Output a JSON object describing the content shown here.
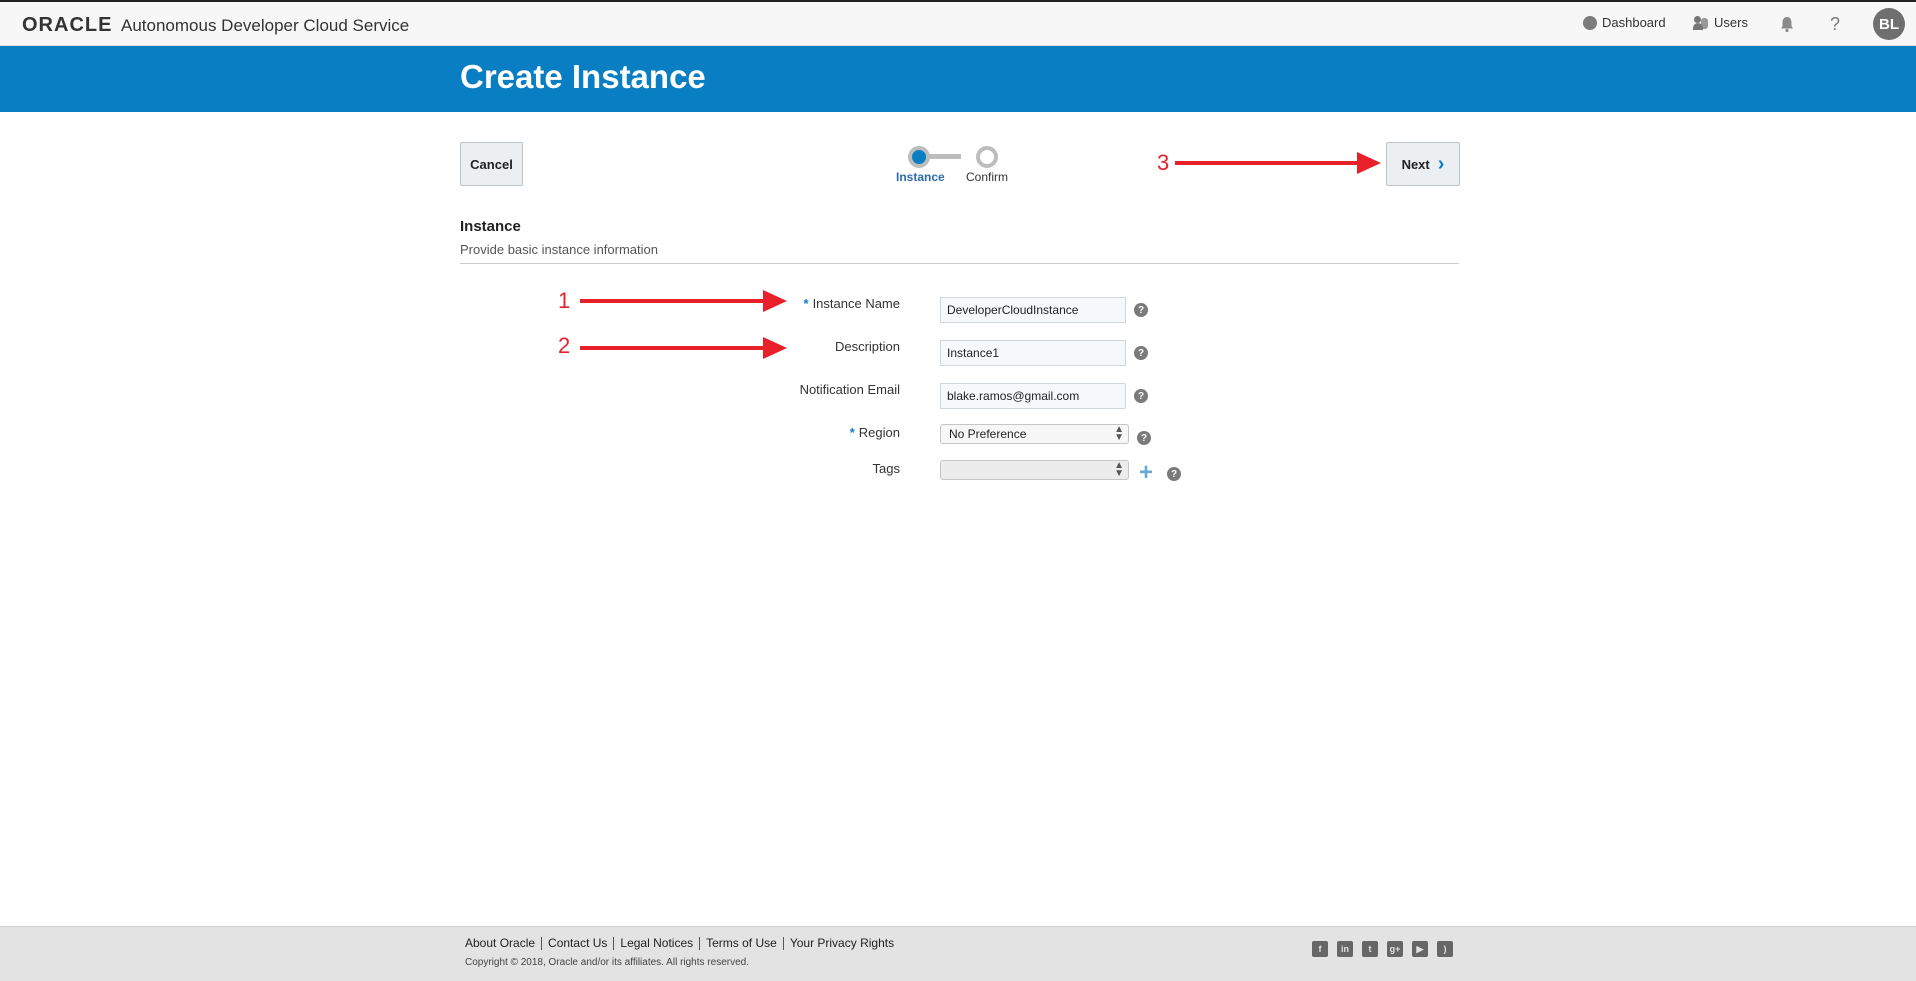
{
  "header": {
    "logo": "ORACLE",
    "app_title": "Autonomous Developer Cloud Service",
    "nav": {
      "dashboard": "Dashboard",
      "users": "Users"
    },
    "help": "?",
    "avatar_initials": "BL"
  },
  "banner": {
    "title": "Create Instance"
  },
  "wizard": {
    "cancel_label": "Cancel",
    "next_label": "Next",
    "steps": [
      "Instance",
      "Confirm"
    ],
    "current_step": "Instance"
  },
  "section": {
    "title": "Instance",
    "subtitle": "Provide basic instance information"
  },
  "form": {
    "instance_name": {
      "label": "Instance Name",
      "value": "DeveloperCloudInstance",
      "required": true
    },
    "description": {
      "label": "Description",
      "value": "Instance1"
    },
    "notification_email": {
      "label": "Notification Email",
      "value": "blake.ramos@gmail.com"
    },
    "region": {
      "label": "Region",
      "value": "No Preference",
      "required": true
    },
    "tags": {
      "label": "Tags",
      "value": ""
    },
    "required_marker": "*",
    "help_icon": "?"
  },
  "annotations": [
    "1",
    "2",
    "3"
  ],
  "footer": {
    "links": [
      "About Oracle",
      "Contact Us",
      "Legal Notices",
      "Terms of Use",
      "Your Privacy Rights"
    ],
    "copyright": "Copyright © 2018, Oracle and/or its affiliates. All rights reserved.",
    "social": [
      "facebook-icon",
      "linkedin-icon",
      "twitter-icon",
      "google-plus-icon",
      "youtube-icon",
      "rss-icon"
    ]
  },
  "colors": {
    "accent": "#0a7ec2",
    "annotation": "#e8202a"
  }
}
